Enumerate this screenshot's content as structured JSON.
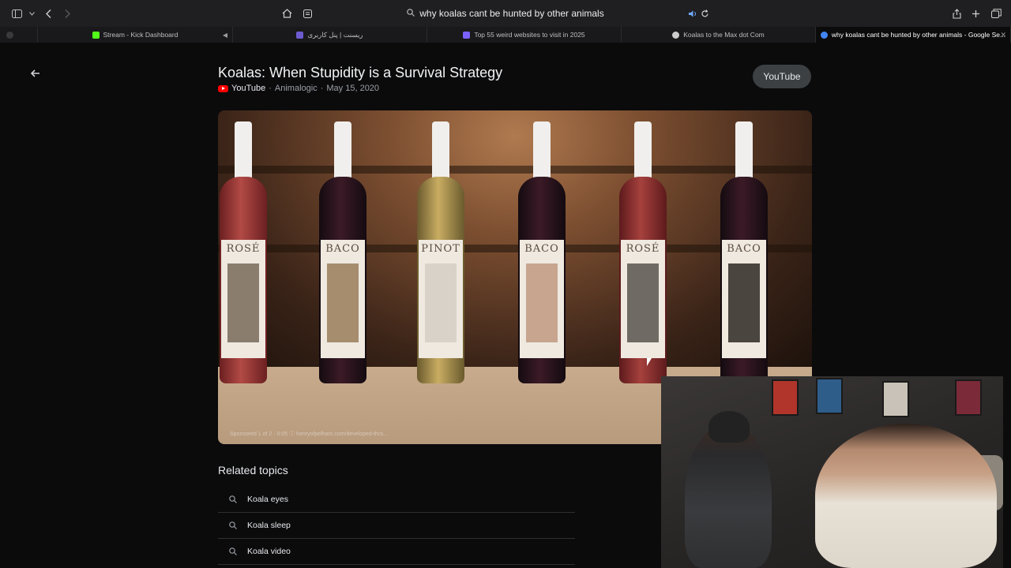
{
  "toolbar": {
    "address": "why koalas cant be hunted by other animals",
    "icons": [
      "sidebar-icon",
      "chevron-down-icon",
      "back-arrow-icon",
      "forward-arrow-icon",
      "home-icon",
      "reader-icon",
      "search-icon",
      "audio-icon",
      "reload-icon",
      "share-icon",
      "plus-icon",
      "tabs-overview-icon"
    ]
  },
  "tabs": [
    {
      "label": "Stream - Kick Dashboard",
      "fav_color": "#53fc18"
    },
    {
      "label": "ریسنت | پنل کاربری",
      "fav_color": "#6d5bd0"
    },
    {
      "label": "Top 55 weird websites to visit in 2025",
      "fav_color": "#7b61ff"
    },
    {
      "label": "Koalas to the Max dot Com",
      "fav_color": "#cccccc"
    },
    {
      "label": "why koalas cant be hunted by other animals - Google Se...",
      "fav_color": "#4285f4"
    }
  ],
  "video": {
    "title": "Koalas: When Stupidity is a Survival Strategy",
    "source": "YouTube",
    "channel": "Animalogic",
    "date": "May 15, 2020",
    "separator": "·",
    "button_label": "YouTube",
    "sponsor_text": "Sponsored 1 of 2 · 0:05 ⓘ henryofpelham.com/developed-thro...",
    "bottle_labels": [
      "ROSÉ",
      "BACO",
      "PINOT",
      "BACO",
      "ROSÉ",
      "BACO"
    ]
  },
  "related": {
    "heading": "Related topics",
    "items": [
      "Koala eyes",
      "Koala sleep",
      "Koala video"
    ]
  },
  "colors": {
    "background": "#0b0b0c",
    "button_bg": "#3c4043",
    "youtube_red": "#ff0000"
  }
}
